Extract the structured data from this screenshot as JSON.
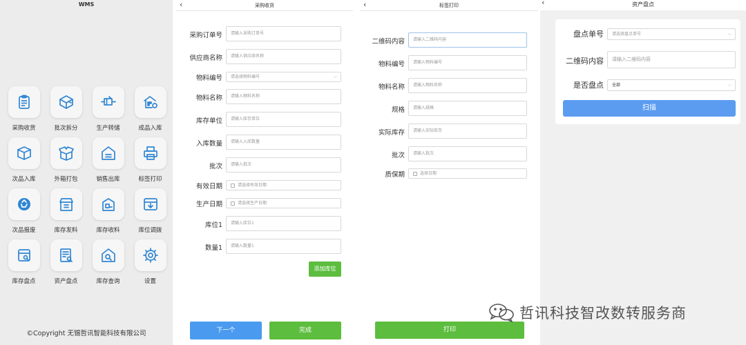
{
  "p1": {
    "title": "WMS",
    "items": [
      {
        "label": "采购收货",
        "icon": "clipboard-icon"
      },
      {
        "label": "批次拆分",
        "icon": "box-split-icon"
      },
      {
        "label": "生产转储",
        "icon": "truck-icon"
      },
      {
        "label": "成品入库",
        "icon": "warehouse-icon"
      },
      {
        "label": "次品入库",
        "icon": "cube-icon"
      },
      {
        "label": "外箱打包",
        "icon": "open-box-icon"
      },
      {
        "label": "销售出库",
        "icon": "house-icon"
      },
      {
        "label": "标签打印",
        "icon": "printer-icon"
      },
      {
        "label": "次品报废",
        "icon": "recycle-icon"
      },
      {
        "label": "库存发料",
        "icon": "store-icon"
      },
      {
        "label": "库存收料",
        "icon": "shelf-box-icon"
      },
      {
        "label": "库位调拨",
        "icon": "transfer-box-icon"
      },
      {
        "label": "库存盘点",
        "icon": "inventory-icon"
      },
      {
        "label": "资产盘点",
        "icon": "asset-list-icon"
      },
      {
        "label": "库存查询",
        "icon": "house-search-icon"
      },
      {
        "label": "设置",
        "icon": "gear-icon"
      }
    ],
    "copyright": "©Copyright 无锡哲讯智能科技有限公司"
  },
  "p2": {
    "title": "采购收货",
    "fields": [
      {
        "label": "采购订单号",
        "placeholder": "请输入采购订单号"
      },
      {
        "label": "供应商名称",
        "placeholder": "请输入供应商名称"
      },
      {
        "label": "物料编号",
        "placeholder": "请选择物料编号"
      },
      {
        "label": "物料名称",
        "placeholder": "请输入物料名称"
      },
      {
        "label": "库存单位",
        "placeholder": "请输入库存单位"
      },
      {
        "label": "入库数量",
        "placeholder": "请输入入库数量"
      },
      {
        "label": "批次",
        "placeholder": "请输入批次"
      },
      {
        "label": "有效日期",
        "placeholder": "请选择有效日期"
      },
      {
        "label": "生产日期",
        "placeholder": "请选择生产日期"
      },
      {
        "label": "库位1",
        "placeholder": "请输入库位1"
      },
      {
        "label": "数量1",
        "placeholder": "请输入数量1"
      }
    ],
    "add_location": "添加库位",
    "next": "下一个",
    "done": "完成"
  },
  "p3": {
    "title": "标签打印",
    "fields": [
      {
        "label": "二维码内容",
        "placeholder": "请输入二维码内容"
      },
      {
        "label": "物料编号",
        "placeholder": "请输入物料编号"
      },
      {
        "label": "物料名称",
        "placeholder": "请输入物料名称"
      },
      {
        "label": "规格",
        "placeholder": "请输入规格"
      },
      {
        "label": "实际库存",
        "placeholder": "请输入实际库存"
      },
      {
        "label": "批次",
        "placeholder": "请输入批次"
      },
      {
        "label": "质保期",
        "placeholder": "选择日期"
      }
    ],
    "print": "打印"
  },
  "p4": {
    "title": "资产盘点",
    "fields": [
      {
        "label": "盘点单号",
        "placeholder": "请选择盘点单号"
      },
      {
        "label": "二维码内容",
        "placeholder": "请输入二维码内容"
      },
      {
        "label": "是否盘点",
        "value": "全部"
      }
    ],
    "scan": "扫描"
  },
  "watermark": "哲讯科技智改数转服务商",
  "colors": {
    "icon": "#2f86d4",
    "blue_button": "#4a9bef",
    "green_button": "#5cbd3e",
    "scan_button": "#5b9cf0"
  }
}
